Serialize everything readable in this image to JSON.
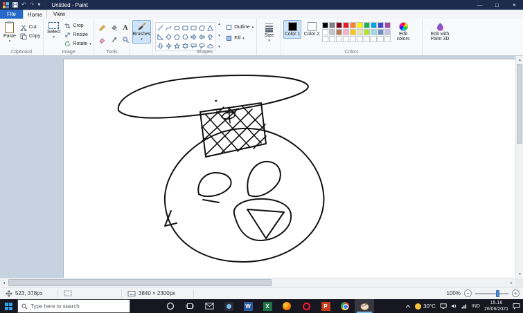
{
  "titlebar": {
    "title": "Untitled - Paint"
  },
  "menu": {
    "tabs": [
      "File",
      "Home",
      "View"
    ]
  },
  "ribbon": {
    "clipboard": {
      "group": "Clipboard",
      "paste": "Paste",
      "cut": "Cut",
      "copy": "Copy"
    },
    "image": {
      "group": "Image",
      "select": "Select",
      "crop": "Crop",
      "resize": "Resize",
      "rotate": "Rotate"
    },
    "tools": {
      "group": "Tools"
    },
    "brushes": {
      "label": "Brushes"
    },
    "shapes": {
      "group": "Shapes",
      "outline": "Outline",
      "fill": "Fill"
    },
    "size": {
      "label": "Size"
    },
    "colors": {
      "group": "Colors",
      "color1_label": "Color 1",
      "color2_label": "Color 2",
      "color1_value": "#000000",
      "color2_value": "#ffffff",
      "edit_colors_label": "Edit colors",
      "palette_row1": [
        "#000000",
        "#7f7f7f",
        "#880015",
        "#ed1c24",
        "#ff7f27",
        "#fff200",
        "#22b14c",
        "#00a2e8",
        "#3f48cc",
        "#a349a4"
      ],
      "palette_row2": [
        "#ffffff",
        "#c3c3c3",
        "#b97a57",
        "#ffaec9",
        "#ffc90e",
        "#efe4b0",
        "#b5e61d",
        "#99d9ea",
        "#7092be",
        "#c8bfe7"
      ]
    },
    "paint3d": {
      "label": "Edit with Paint 3D"
    }
  },
  "statusbar": {
    "cursor_position": "523, 378px",
    "canvas_size": "3840 × 2300px",
    "zoom": "100%"
  },
  "taskbar": {
    "search_placeholder": "Type here to search",
    "apps": [
      "cortana",
      "task-view",
      "mail",
      "photos",
      "word",
      "excel",
      "firefox",
      "opera",
      "powerpoint",
      "chrome",
      "paint"
    ],
    "active_app": "paint",
    "weather_temp": "30°C",
    "language": "IND",
    "time": "15.16",
    "date": "26/06/2021"
  }
}
